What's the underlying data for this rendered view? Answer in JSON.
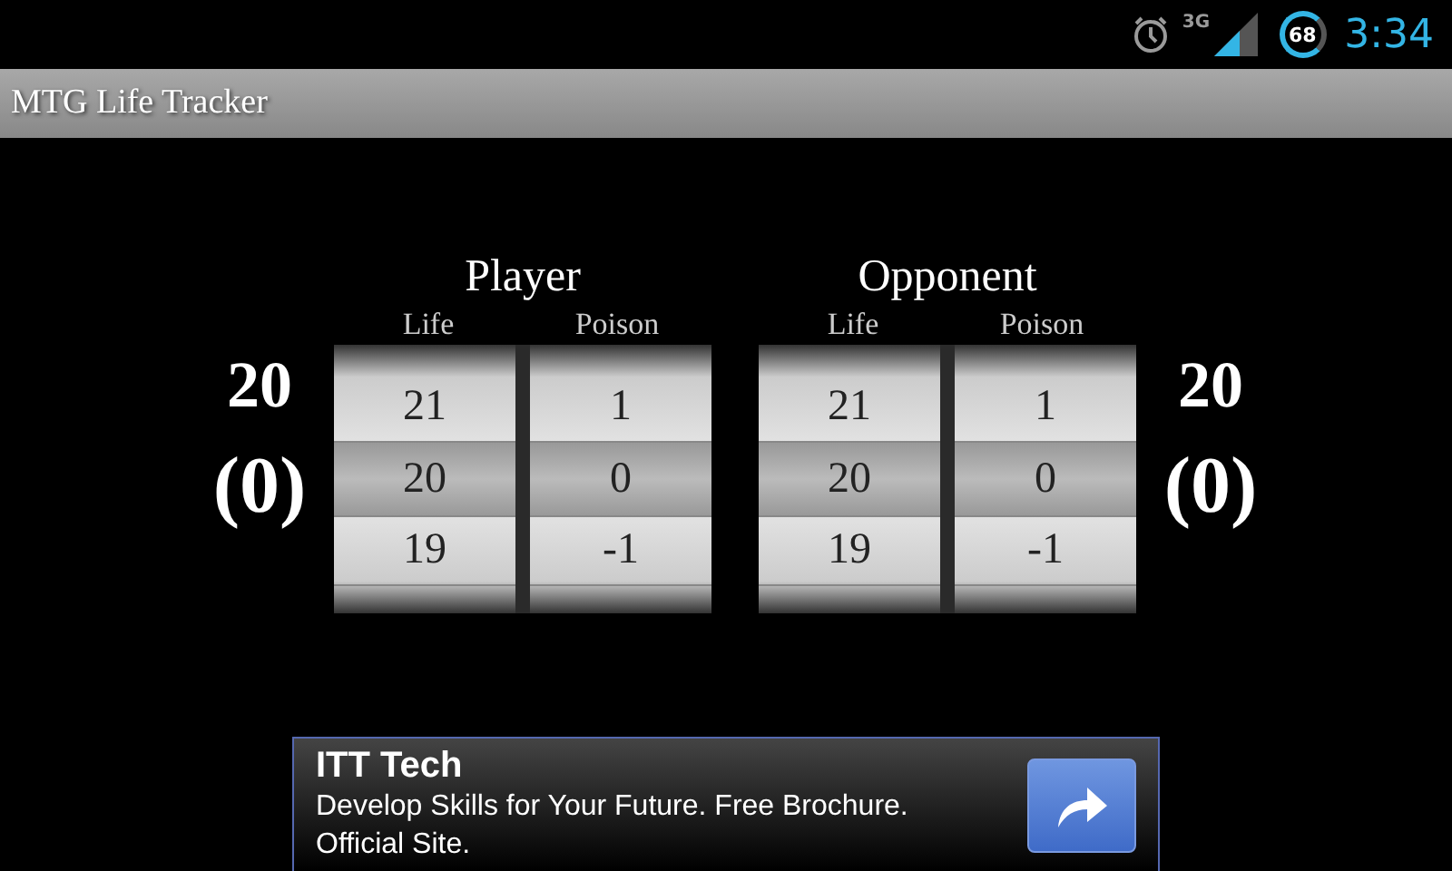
{
  "status_bar": {
    "network": "3G",
    "battery": "68",
    "time": "3:34"
  },
  "title": "MTG Life Tracker",
  "players": [
    {
      "name": "Player",
      "total": "20",
      "poison_total": "(0)",
      "wheels": [
        {
          "label": "Life",
          "values": [
            {
              "text": "21",
              "selected": false
            },
            {
              "text": "20",
              "selected": true
            },
            {
              "text": "19",
              "selected": false
            }
          ]
        },
        {
          "label": "Poison",
          "values": [
            {
              "text": "1",
              "selected": false
            },
            {
              "text": "0",
              "selected": true
            },
            {
              "text": "-1",
              "selected": false
            }
          ]
        }
      ]
    },
    {
      "name": "Opponent",
      "total": "20",
      "poison_total": "(0)",
      "wheels": [
        {
          "label": "Life",
          "values": [
            {
              "text": "21",
              "selected": false
            },
            {
              "text": "20",
              "selected": true
            },
            {
              "text": "19",
              "selected": false
            }
          ]
        },
        {
          "label": "Poison",
          "values": [
            {
              "text": "1",
              "selected": false
            },
            {
              "text": "0",
              "selected": true
            },
            {
              "text": "-1",
              "selected": false
            }
          ]
        }
      ]
    }
  ],
  "ad": {
    "title": "ITT Tech",
    "text": "Develop Skills for Your Future. Free Brochure. Official Site."
  }
}
